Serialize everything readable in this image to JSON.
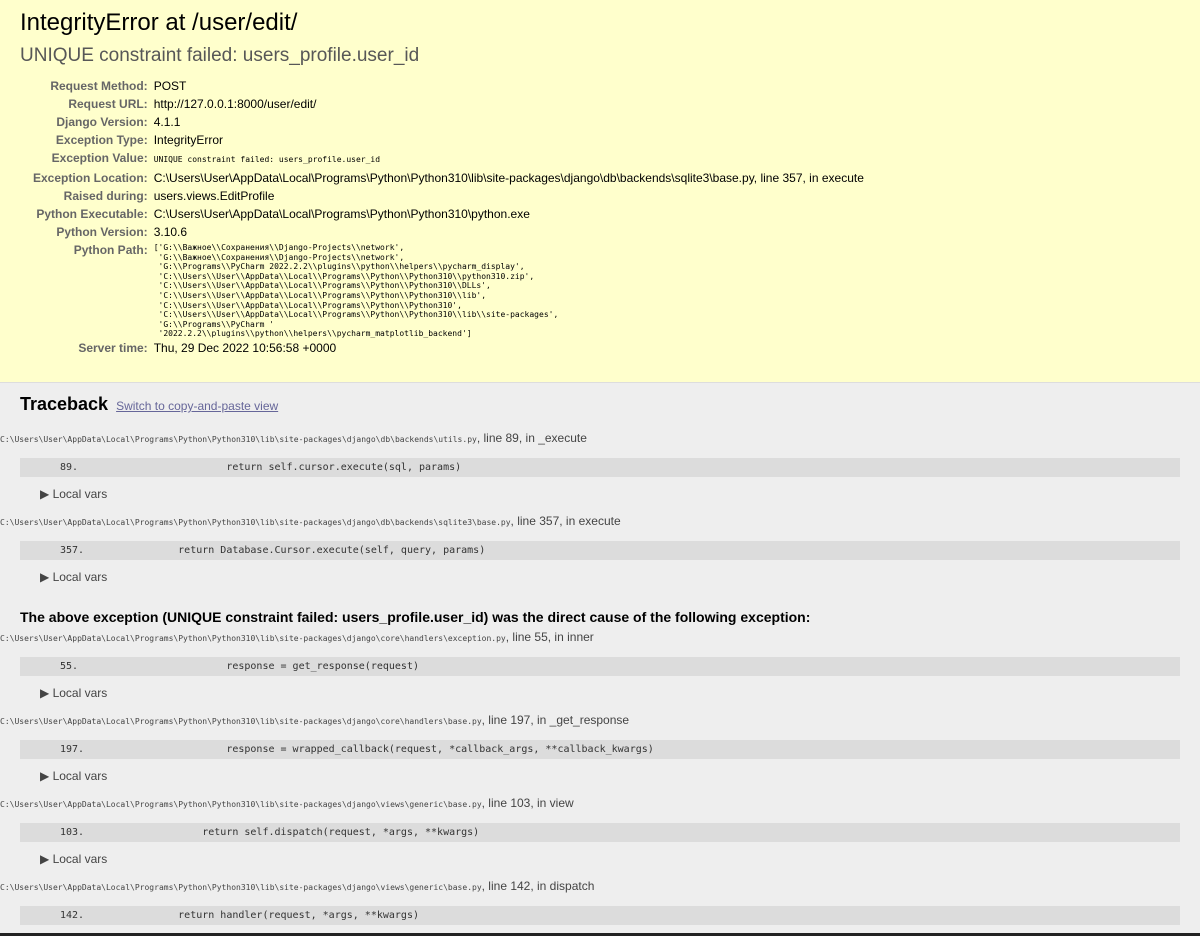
{
  "title": "IntegrityError at /user/edit/",
  "subtitle": "UNIQUE constraint failed: users_profile.user_id",
  "meta": [
    {
      "label": "Request Method:",
      "value": "POST"
    },
    {
      "label": "Request URL:",
      "value": "http://127.0.0.1:8000/user/edit/"
    },
    {
      "label": "Django Version:",
      "value": "4.1.1"
    },
    {
      "label": "Exception Type:",
      "value": "IntegrityError"
    },
    {
      "label": "Exception Value:",
      "value": "UNIQUE constraint failed: users_profile.user_id"
    },
    {
      "label": "Exception Location:",
      "value": "C:\\Users\\User\\AppData\\Local\\Programs\\Python\\Python310\\lib\\site-packages\\django\\db\\backends\\sqlite3\\base.py, line 357, in execute"
    },
    {
      "label": "Raised during:",
      "value": "users.views.EditProfile"
    },
    {
      "label": "Python Executable:",
      "value": "C:\\Users\\User\\AppData\\Local\\Programs\\Python\\Python310\\python.exe"
    },
    {
      "label": "Python Version:",
      "value": "3.10.6"
    },
    {
      "label": "Python Path:",
      "value": "['G:\\\\Важное\\\\Сохранения\\\\Django-Projects\\\\network',\n 'G:\\\\Важное\\\\Сохранения\\\\Django-Projects\\\\network',\n 'G:\\\\Programs\\\\PyCharm 2022.2.2\\\\plugins\\\\python\\\\helpers\\\\pycharm_display',\n 'C:\\\\Users\\\\User\\\\AppData\\\\Local\\\\Programs\\\\Python\\\\Python310\\\\python310.zip',\n 'C:\\\\Users\\\\User\\\\AppData\\\\Local\\\\Programs\\\\Python\\\\Python310\\\\DLLs',\n 'C:\\\\Users\\\\User\\\\AppData\\\\Local\\\\Programs\\\\Python\\\\Python310\\\\lib',\n 'C:\\\\Users\\\\User\\\\AppData\\\\Local\\\\Programs\\\\Python\\\\Python310',\n 'C:\\\\Users\\\\User\\\\AppData\\\\Local\\\\Programs\\\\Python\\\\Python310\\\\lib\\\\site-packages',\n 'G:\\\\Programs\\\\PyCharm '\n '2022.2.2\\\\plugins\\\\python\\\\helpers\\\\pycharm_matplotlib_backend']"
    },
    {
      "label": "Server time:",
      "value": "Thu, 29 Dec 2022 10:56:58 +0000"
    }
  ],
  "traceback": {
    "heading": "Traceback",
    "switch_link": "Switch to copy-and-paste view",
    "local_vars_label": "▶ Local vars",
    "cause_text": "The above exception (UNIQUE constraint failed: users_profile.user_id) was the direct cause of the following exception:",
    "frames": [
      {
        "file": "C:\\Users\\User\\AppData\\Local\\Programs\\Python\\Python310\\lib\\site-packages\\django\\db\\backends\\utils.py",
        "where": ", line 89, in _execute",
        "line_no": "89.",
        "code": "                return self.cursor.execute(sql, params)"
      },
      {
        "file": "C:\\Users\\User\\AppData\\Local\\Programs\\Python\\Python310\\lib\\site-packages\\django\\db\\backends\\sqlite3\\base.py",
        "where": ", line 357, in execute",
        "line_no": "357.",
        "code": "        return Database.Cursor.execute(self, query, params)"
      },
      {
        "file": "C:\\Users\\User\\AppData\\Local\\Programs\\Python\\Python310\\lib\\site-packages\\django\\core\\handlers\\exception.py",
        "where": ", line 55, in inner",
        "line_no": "55.",
        "code": "                response = get_response(request)"
      },
      {
        "file": "C:\\Users\\User\\AppData\\Local\\Programs\\Python\\Python310\\lib\\site-packages\\django\\core\\handlers\\base.py",
        "where": ", line 197, in _get_response",
        "line_no": "197.",
        "code": "                response = wrapped_callback(request, *callback_args, **callback_kwargs)"
      },
      {
        "file": "C:\\Users\\User\\AppData\\Local\\Programs\\Python\\Python310\\lib\\site-packages\\django\\views\\generic\\base.py",
        "where": ", line 103, in view",
        "line_no": "103.",
        "code": "            return self.dispatch(request, *args, **kwargs)"
      },
      {
        "file": "C:\\Users\\User\\AppData\\Local\\Programs\\Python\\Python310\\lib\\site-packages\\django\\views\\generic\\base.py",
        "where": ", line 142, in dispatch",
        "line_no": "142.",
        "code": "        return handler(request, *args, **kwargs)"
      }
    ]
  }
}
